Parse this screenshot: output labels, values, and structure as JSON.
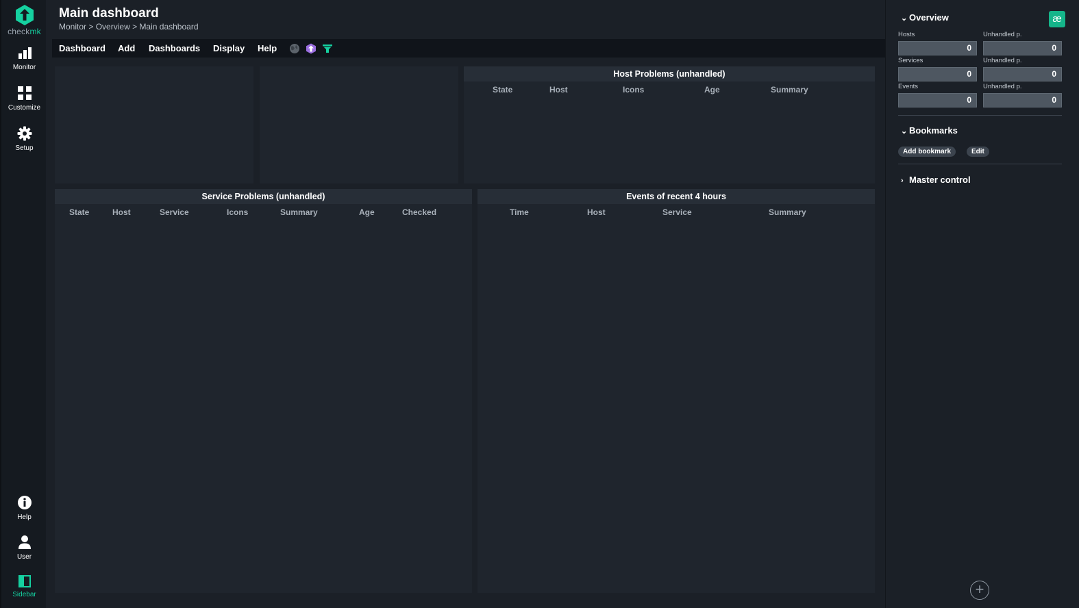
{
  "brand": {
    "prefix": "check",
    "suffix": "mk"
  },
  "nav": {
    "monitor": "Monitor",
    "customize": "Customize",
    "setup": "Setup",
    "help": "Help",
    "user": "User",
    "sidebar": "Sidebar"
  },
  "page": {
    "title": "Main dashboard",
    "breadcrumb": [
      "Monitor",
      "Overview",
      "Main dashboard"
    ],
    "breadcrumb_sep": ">"
  },
  "menu": {
    "dashboard": "Dashboard",
    "add": "Add",
    "dashboards": "Dashboards",
    "display": "Display",
    "help": "Help"
  },
  "dashlets": {
    "host_problems": {
      "title": "Host Problems (unhandled)",
      "columns": [
        "State",
        "Host",
        "Icons",
        "Age",
        "Summary"
      ]
    },
    "service_problems": {
      "title": "Service Problems (unhandled)",
      "columns": [
        "State",
        "Host",
        "Service",
        "Icons",
        "Summary",
        "Age",
        "Checked"
      ]
    },
    "events": {
      "title": "Events of recent 4 hours",
      "columns": [
        "Time",
        "Host",
        "Service",
        "Summary"
      ]
    }
  },
  "sidebar": {
    "badge": "æ",
    "overview": {
      "title": "Overview",
      "rows": [
        {
          "label": "Hosts",
          "value": "0",
          "unhandled_label": "Unhandled p.",
          "unhandled_value": "0"
        },
        {
          "label": "Services",
          "value": "0",
          "unhandled_label": "Unhandled p.",
          "unhandled_value": "0"
        },
        {
          "label": "Events",
          "value": "0",
          "unhandled_label": "Unhandled p.",
          "unhandled_value": "0"
        }
      ]
    },
    "bookmarks": {
      "title": "Bookmarks",
      "add_label": "Add bookmark",
      "edit_label": "Edit"
    },
    "master_control": {
      "title": "Master control"
    }
  },
  "colors": {
    "accent": "#15d1a0",
    "background": "#1b2027",
    "dashlet": "#1f252d",
    "nav": "#151a20"
  },
  "icons": {
    "logo": "checkmk-logo-icon",
    "monitor": "bar-chart-icon",
    "customize": "grid-icon",
    "setup": "gear-icon",
    "help": "info-icon",
    "user": "user-icon",
    "sidebar": "sidebar-toggle-icon"
  }
}
